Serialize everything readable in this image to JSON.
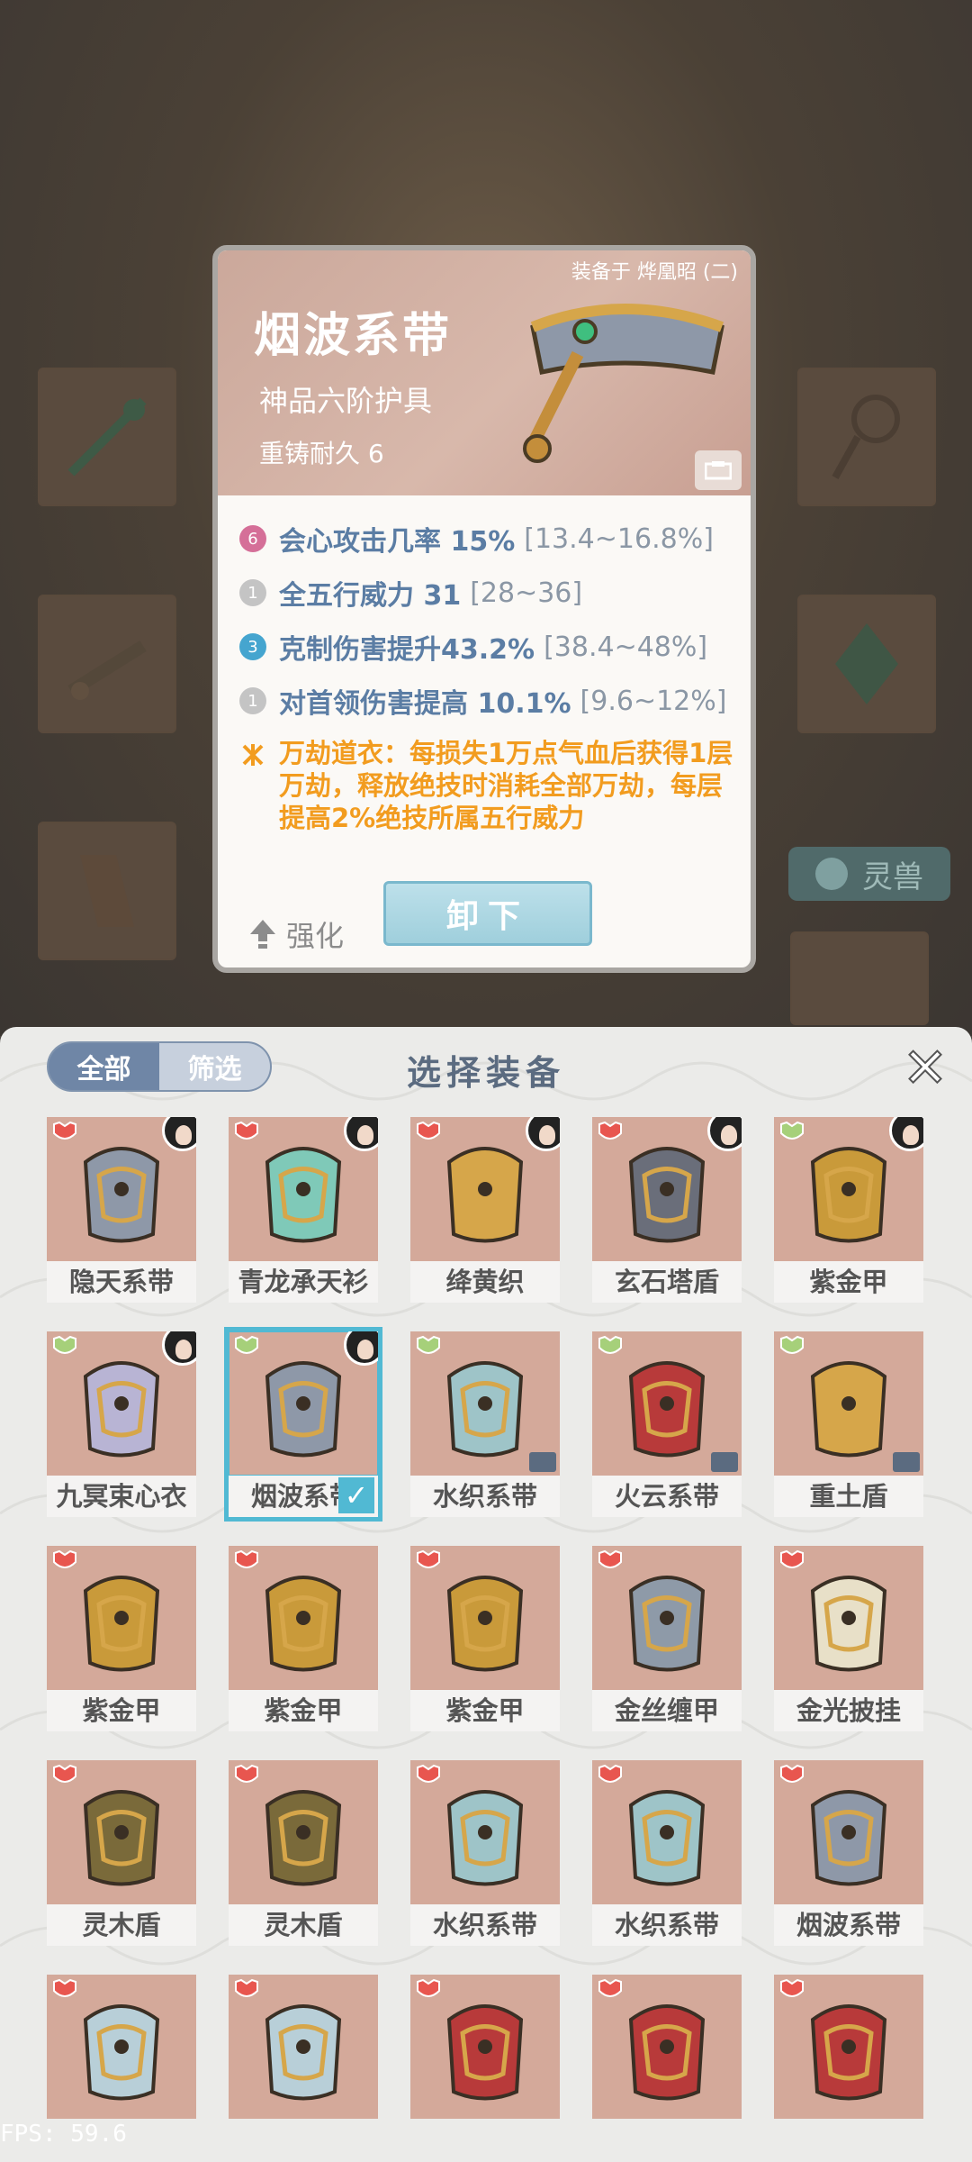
{
  "detail": {
    "equipped_on": "装备于 烨凰昭 (二)",
    "name": "烟波系带",
    "grade": "神品六阶护具",
    "reforge": "重铸耐久 6",
    "attrs": [
      {
        "badge": "6",
        "text": "会心攻击几率 15%",
        "range": "[13.4~16.8%]",
        "color": "pink"
      },
      {
        "badge": "1",
        "text": "全五行威力 31",
        "range": "[28~36]",
        "color": "gray"
      },
      {
        "badge": "3",
        "text": "克制伤害提升43.2%",
        "range": "[38.4~48%]",
        "color": "blue"
      },
      {
        "badge": "1",
        "text": "对首领伤害提高 10.1%",
        "range": "[9.6~12%]",
        "color": "gray"
      }
    ],
    "skill_text": "万劫道衣：每损失1万点气血后获得1层万劫，释放绝技时消耗全部万劫，每层提高2%绝技所属五行威力",
    "enhance_label": "强化",
    "unequip_label": "卸下"
  },
  "background": {
    "beast_button_label": "灵兽"
  },
  "panel": {
    "tabs": [
      "全部",
      "筛选"
    ],
    "title": "选择装备",
    "close_icon": "close-icon",
    "items": [
      {
        "name": "隐天系带",
        "portrait": true
      },
      {
        "name": "青龙承天衫",
        "portrait": true
      },
      {
        "name": "绛黄织",
        "portrait": true
      },
      {
        "name": "玄石塔盾",
        "portrait": true
      },
      {
        "name": "紫金甲",
        "portrait": true
      },
      {
        "name": "九冥束心衣",
        "portrait": true
      },
      {
        "name": "烟波系带",
        "portrait": true,
        "selected": true
      },
      {
        "name": "水织系带",
        "lock": true
      },
      {
        "name": "火云系带",
        "lock": true
      },
      {
        "name": "重土盾",
        "lock": true
      },
      {
        "name": "紫金甲"
      },
      {
        "name": "紫金甲"
      },
      {
        "name": "紫金甲"
      },
      {
        "name": "金丝缠甲"
      },
      {
        "name": "金光披挂"
      },
      {
        "name": "灵木盾"
      },
      {
        "name": "灵木盾"
      },
      {
        "name": "水织系带"
      },
      {
        "name": "水织系带"
      },
      {
        "name": "烟波系带"
      },
      {
        "name": ""
      },
      {
        "name": ""
      },
      {
        "name": ""
      },
      {
        "name": ""
      },
      {
        "name": ""
      }
    ]
  },
  "fps": "FPS: 59.6",
  "colors": {
    "accent": "#51b9d3",
    "skill": "#f29c1f",
    "attr": "#5b7da4"
  }
}
